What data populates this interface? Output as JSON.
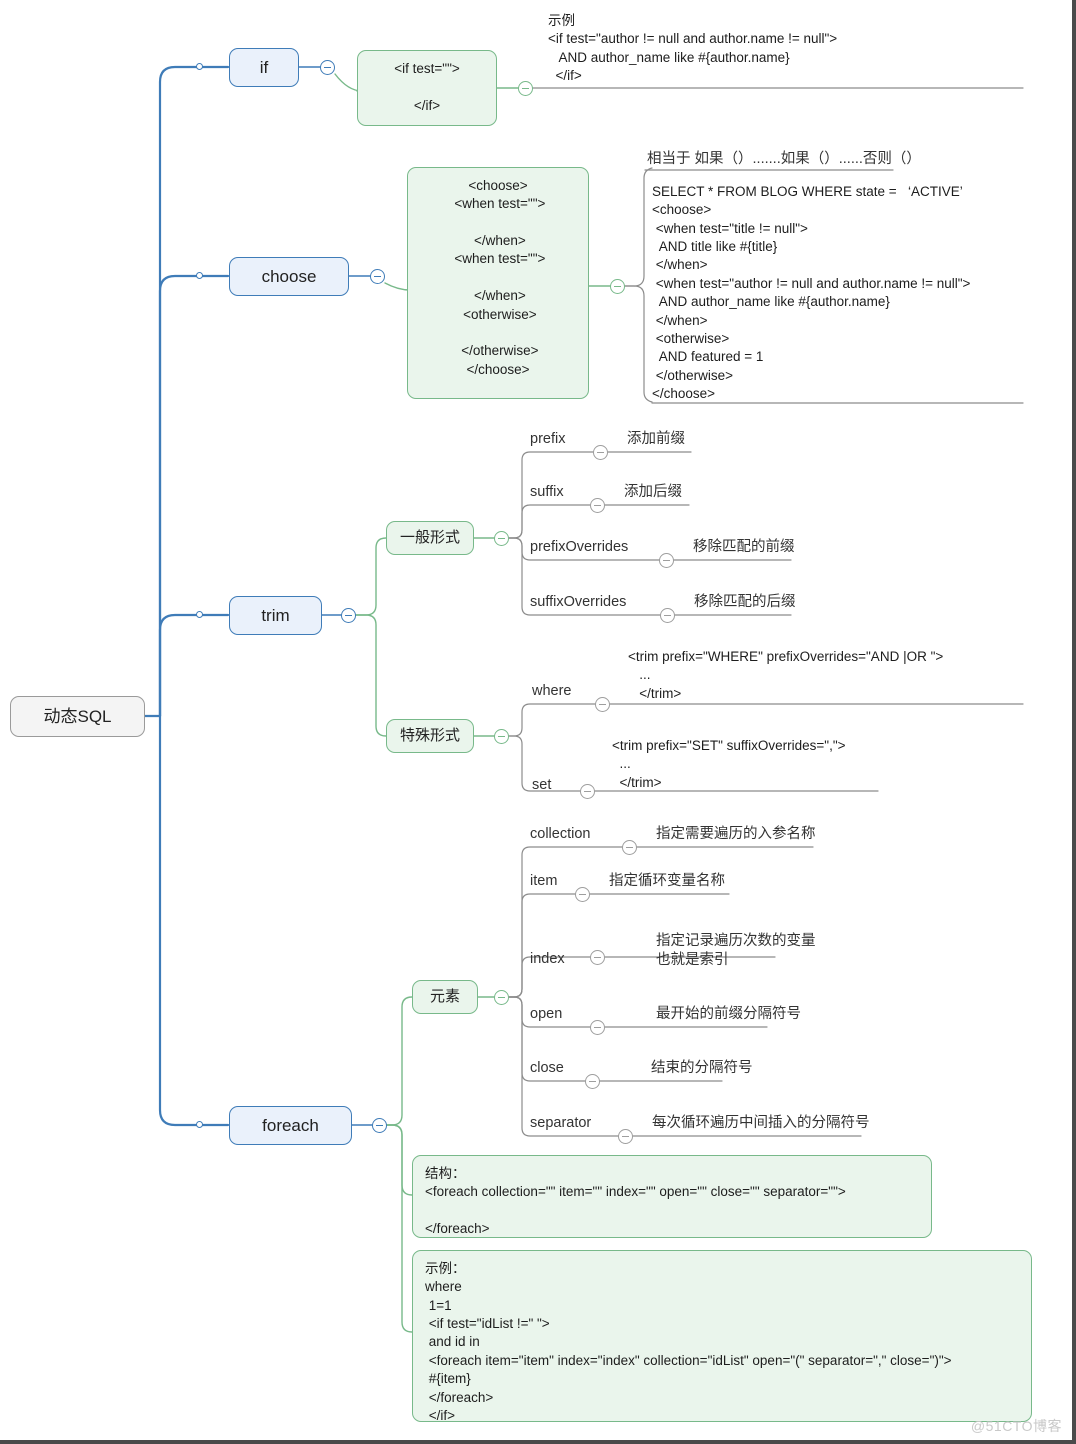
{
  "diagram": {
    "title": "动态SQL",
    "watermark": "@51CTO博客",
    "colors": {
      "blue_border": "#3f7cb8",
      "blue_fill": "#eaf1fb",
      "green_border": "#78b98a",
      "green_fill": "#eaf5ec",
      "gray_border": "#9e9e9e",
      "root_fill": "#f4f4f4"
    }
  },
  "root": {
    "label": "动态SQL"
  },
  "branches": {
    "if": {
      "label": "if",
      "code": "<if test=\"\">\n\n</if>",
      "example": "示例\n<if test=\"author != null and author.name != null\">\n   AND author_name like #{author.name}\n  </if>"
    },
    "choose": {
      "label": "choose",
      "code": "<choose>\n <when test=\"\">\n\n </when>\n <when test=\"\">\n\n </when>\n <otherwise>\n\n </otherwise>\n</choose>",
      "note": "相当于 如果（）.......如果（）......否则（）",
      "example": "SELECT * FROM BLOG WHERE state =   ‘ACTIVE’\n<choose>\n <when test=\"title != null\">\n  AND title like #{title}\n </when>\n <when test=\"author != null and author.name != null\">\n  AND author_name like #{author.name}\n </when>\n <otherwise>\n  AND featured = 1\n </otherwise>\n</choose>"
    },
    "trim": {
      "label": "trim",
      "general": {
        "label": "一般形式",
        "attributes": [
          {
            "name": "prefix",
            "desc": "添加前缀"
          },
          {
            "name": "suffix",
            "desc": "添加后缀"
          },
          {
            "name": "prefixOverrides",
            "desc": "移除匹配的前缀"
          },
          {
            "name": "suffixOverrides",
            "desc": "移除匹配的后缀"
          }
        ]
      },
      "special": {
        "label": "特殊形式",
        "items": [
          {
            "name": "where",
            "code": "<trim prefix=\"WHERE\" prefixOverrides=\"AND |OR \">\n   ...\n   </trim>"
          },
          {
            "name": "set",
            "code": "<trim prefix=\"SET\" suffixOverrides=\",\">\n  ...\n  </trim>"
          }
        ]
      }
    },
    "foreach": {
      "label": "foreach",
      "elements": {
        "label": "元素",
        "attributes": [
          {
            "name": "collection",
            "desc": "指定需要遍历的入参名称"
          },
          {
            "name": "item",
            "desc": "指定循环变量名称"
          },
          {
            "name": "index",
            "desc": "指定记录遍历次数的变量\n也就是索引"
          },
          {
            "name": "open",
            "desc": "最开始的前缀分隔符号"
          },
          {
            "name": "close",
            "desc": "结束的分隔符号"
          },
          {
            "name": "separator",
            "desc": "每次循环遍历中间插入的分隔符号"
          }
        ]
      },
      "structure": "结构：\n<foreach collection=\"\" item=\"\" index=\"\" open=\"\" close=\"\" separator=\"\">\n\n</foreach>",
      "example": "示例：\nwhere\n 1=1\n <if test=\"idList !=\" \">\n and id in\n <foreach item=\"item\" index=\"index\" collection=\"idList\" open=\"(\" separator=\",\" close=\")\">\n #{item}\n </foreach>\n </if>"
    }
  },
  "chart_data": {
    "type": "table",
    "title": "动态SQL",
    "nodes": [
      {
        "level": 0,
        "label": "动态SQL",
        "children": [
          "if",
          "choose",
          "trim",
          "foreach"
        ]
      },
      {
        "level": 1,
        "label": "if",
        "children": [
          "<if test=\"\"> ... </if>"
        ]
      },
      {
        "level": 1,
        "label": "choose",
        "children": [
          "<choose>...</choose>"
        ]
      },
      {
        "level": 1,
        "label": "trim",
        "children": [
          "一般形式",
          "特殊形式"
        ]
      },
      {
        "level": 1,
        "label": "foreach",
        "children": [
          "元素",
          "结构",
          "示例"
        ]
      }
    ]
  }
}
